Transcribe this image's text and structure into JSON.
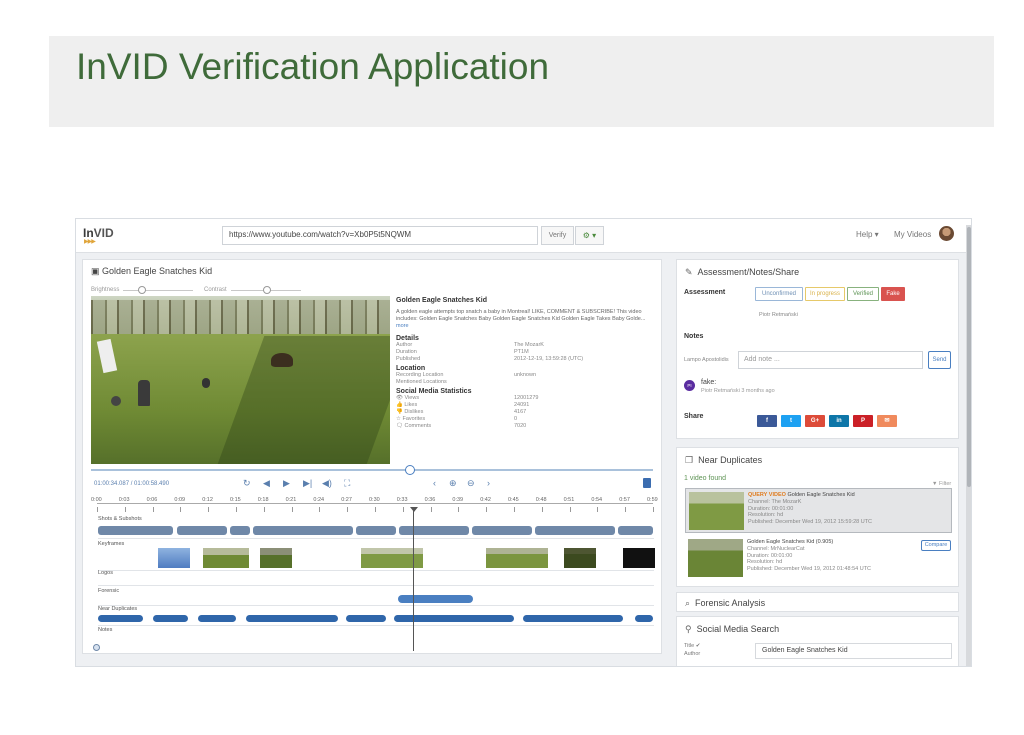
{
  "slide": {
    "title": "InVID Verification Application"
  },
  "topbar": {
    "logo_in": "In",
    "logo_vid": "VID",
    "url": "https://www.youtube.com/watch?v=Xb0P5t5NQWM",
    "verify_label": "Verify",
    "gear_label": "⚙ ▾",
    "help_label": "Help ▾",
    "my_videos_label": "My Videos"
  },
  "video_panel": {
    "title": "Golden Eagle Snatches Kid",
    "brightness_label": "Brightness",
    "contrast_label": "Contrast",
    "meta": {
      "title": "Golden Eagle Snatches Kid",
      "description": "A golden eagle attempts top snatch a baby in Montreal! LIKE, COMMENT & SUBSCRIBE! This video includes: Golden Eagle Snatches Baby Golden Eagle Snatches Kid Golden Eagle Takes Baby Golde...",
      "more": "more",
      "details_heading": "Details",
      "details": [
        {
          "k": "Author",
          "v": "The MozarK"
        },
        {
          "k": "Duration",
          "v": "PT1M"
        },
        {
          "k": "Published",
          "v": "2012-12-19, 13:59:28 (UTC)"
        }
      ],
      "location_heading": "Location",
      "location": [
        {
          "k": "Recording Location",
          "v": "unknown"
        },
        {
          "k": "Mentioned Locations",
          "v": ""
        }
      ],
      "stats_heading": "Social Media Statistics",
      "stats": [
        {
          "k": "👁 Views",
          "v": "12001279"
        },
        {
          "k": "👍 Likes",
          "v": "24091"
        },
        {
          "k": "👎 Dislikes",
          "v": "4167"
        },
        {
          "k": "☆ Favorites",
          "v": "0"
        },
        {
          "k": "🗨 Comments",
          "v": "7020"
        }
      ]
    },
    "time": "01:00:34.087 / 01:00:58.490",
    "ticks": [
      "0:00",
      "0:03",
      "0:06",
      "0:09",
      "0:12",
      "0:15",
      "0:18",
      "0:21",
      "0:24",
      "0:27",
      "0:30",
      "0:33",
      "0:36",
      "0:39",
      "0:42",
      "0:45",
      "0:48",
      "0:51",
      "0:54",
      "0:57",
      "0:59"
    ],
    "tracks": {
      "shots": "Shots & Subshots",
      "keyframes": "Keyframes",
      "logos": "Logos",
      "forensic": "Forensic",
      "near_duplicates": "Near Duplicates",
      "notes": "Notes"
    }
  },
  "assessment": {
    "title": "Assessment/Notes/Share",
    "assessment_label": "Assessment",
    "badges": [
      "Unconfirmed",
      "In progress",
      "Verified",
      "Fake"
    ],
    "assessor": "Piotr Retmański",
    "notes_label": "Notes",
    "note_user": "Lampo Apostolidis",
    "note_placeholder": "Add note ...",
    "send_label": "Send",
    "note_avatar": "PI",
    "note_text": "fake:",
    "note_meta": "Piotr Retmański 3 months ago",
    "share_label": "Share",
    "share_buttons": [
      "f",
      "t",
      "G+",
      "in",
      "P",
      "✉"
    ]
  },
  "near_duplicates": {
    "title": "Near Duplicates",
    "found": "1 video found",
    "filter": "Filter",
    "query_tag": "QUERY VIDEO",
    "query_name": "Golden Eagle Snatches Kid",
    "query_lines": [
      "Channel: The MozarK",
      "Duration: 00:01:00",
      "Resolution: hd",
      "Published: December Wed 19, 2012 15:59:28 UTC"
    ],
    "dup_name": "Golden Eagle Snatches Kid (0.905)",
    "dup_lines": [
      "Channel: MrNuclearCat",
      "Duration: 00:01:00",
      "Resolution: hd",
      "Published: December Wed 19, 2012 01:48:54 UTC"
    ],
    "compare_label": "Compare"
  },
  "forensic": {
    "title": "Forensic Analysis"
  },
  "social_search": {
    "title": "Social Media Search",
    "title_label": "Title ✔",
    "author_label": "Author",
    "query_value": "Golden Eagle Snatches Kid"
  },
  "colors": {
    "accent": "#3c6db0",
    "fake": "#d9534f",
    "query": "#e07c1f"
  }
}
